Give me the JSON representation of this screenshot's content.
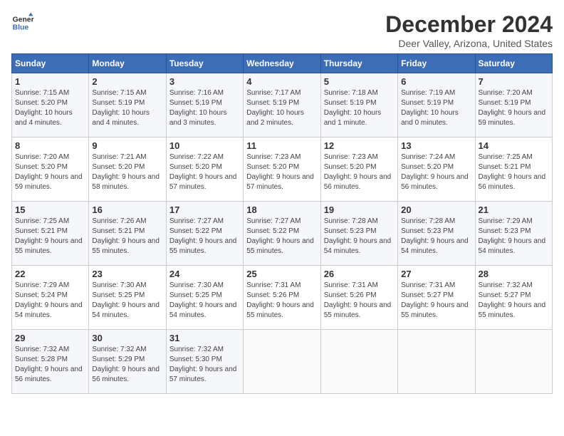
{
  "header": {
    "logo_line1": "General",
    "logo_line2": "Blue",
    "title": "December 2024",
    "location": "Deer Valley, Arizona, United States"
  },
  "days_of_week": [
    "Sunday",
    "Monday",
    "Tuesday",
    "Wednesday",
    "Thursday",
    "Friday",
    "Saturday"
  ],
  "weeks": [
    [
      {
        "day": "1",
        "sunrise": "7:15 AM",
        "sunset": "5:20 PM",
        "daylight": "10 hours and 4 minutes."
      },
      {
        "day": "2",
        "sunrise": "7:15 AM",
        "sunset": "5:19 PM",
        "daylight": "10 hours and 4 minutes."
      },
      {
        "day": "3",
        "sunrise": "7:16 AM",
        "sunset": "5:19 PM",
        "daylight": "10 hours and 3 minutes."
      },
      {
        "day": "4",
        "sunrise": "7:17 AM",
        "sunset": "5:19 PM",
        "daylight": "10 hours and 2 minutes."
      },
      {
        "day": "5",
        "sunrise": "7:18 AM",
        "sunset": "5:19 PM",
        "daylight": "10 hours and 1 minute."
      },
      {
        "day": "6",
        "sunrise": "7:19 AM",
        "sunset": "5:19 PM",
        "daylight": "10 hours and 0 minutes."
      },
      {
        "day": "7",
        "sunrise": "7:20 AM",
        "sunset": "5:19 PM",
        "daylight": "9 hours and 59 minutes."
      }
    ],
    [
      {
        "day": "8",
        "sunrise": "7:20 AM",
        "sunset": "5:20 PM",
        "daylight": "9 hours and 59 minutes."
      },
      {
        "day": "9",
        "sunrise": "7:21 AM",
        "sunset": "5:20 PM",
        "daylight": "9 hours and 58 minutes."
      },
      {
        "day": "10",
        "sunrise": "7:22 AM",
        "sunset": "5:20 PM",
        "daylight": "9 hours and 57 minutes."
      },
      {
        "day": "11",
        "sunrise": "7:23 AM",
        "sunset": "5:20 PM",
        "daylight": "9 hours and 57 minutes."
      },
      {
        "day": "12",
        "sunrise": "7:23 AM",
        "sunset": "5:20 PM",
        "daylight": "9 hours and 56 minutes."
      },
      {
        "day": "13",
        "sunrise": "7:24 AM",
        "sunset": "5:20 PM",
        "daylight": "9 hours and 56 minutes."
      },
      {
        "day": "14",
        "sunrise": "7:25 AM",
        "sunset": "5:21 PM",
        "daylight": "9 hours and 56 minutes."
      }
    ],
    [
      {
        "day": "15",
        "sunrise": "7:25 AM",
        "sunset": "5:21 PM",
        "daylight": "9 hours and 55 minutes."
      },
      {
        "day": "16",
        "sunrise": "7:26 AM",
        "sunset": "5:21 PM",
        "daylight": "9 hours and 55 minutes."
      },
      {
        "day": "17",
        "sunrise": "7:27 AM",
        "sunset": "5:22 PM",
        "daylight": "9 hours and 55 minutes."
      },
      {
        "day": "18",
        "sunrise": "7:27 AM",
        "sunset": "5:22 PM",
        "daylight": "9 hours and 55 minutes."
      },
      {
        "day": "19",
        "sunrise": "7:28 AM",
        "sunset": "5:23 PM",
        "daylight": "9 hours and 54 minutes."
      },
      {
        "day": "20",
        "sunrise": "7:28 AM",
        "sunset": "5:23 PM",
        "daylight": "9 hours and 54 minutes."
      },
      {
        "day": "21",
        "sunrise": "7:29 AM",
        "sunset": "5:23 PM",
        "daylight": "9 hours and 54 minutes."
      }
    ],
    [
      {
        "day": "22",
        "sunrise": "7:29 AM",
        "sunset": "5:24 PM",
        "daylight": "9 hours and 54 minutes."
      },
      {
        "day": "23",
        "sunrise": "7:30 AM",
        "sunset": "5:25 PM",
        "daylight": "9 hours and 54 minutes."
      },
      {
        "day": "24",
        "sunrise": "7:30 AM",
        "sunset": "5:25 PM",
        "daylight": "9 hours and 54 minutes."
      },
      {
        "day": "25",
        "sunrise": "7:31 AM",
        "sunset": "5:26 PM",
        "daylight": "9 hours and 55 minutes."
      },
      {
        "day": "26",
        "sunrise": "7:31 AM",
        "sunset": "5:26 PM",
        "daylight": "9 hours and 55 minutes."
      },
      {
        "day": "27",
        "sunrise": "7:31 AM",
        "sunset": "5:27 PM",
        "daylight": "9 hours and 55 minutes."
      },
      {
        "day": "28",
        "sunrise": "7:32 AM",
        "sunset": "5:27 PM",
        "daylight": "9 hours and 55 minutes."
      }
    ],
    [
      {
        "day": "29",
        "sunrise": "7:32 AM",
        "sunset": "5:28 PM",
        "daylight": "9 hours and 56 minutes."
      },
      {
        "day": "30",
        "sunrise": "7:32 AM",
        "sunset": "5:29 PM",
        "daylight": "9 hours and 56 minutes."
      },
      {
        "day": "31",
        "sunrise": "7:32 AM",
        "sunset": "5:30 PM",
        "daylight": "9 hours and 57 minutes."
      },
      null,
      null,
      null,
      null
    ]
  ]
}
